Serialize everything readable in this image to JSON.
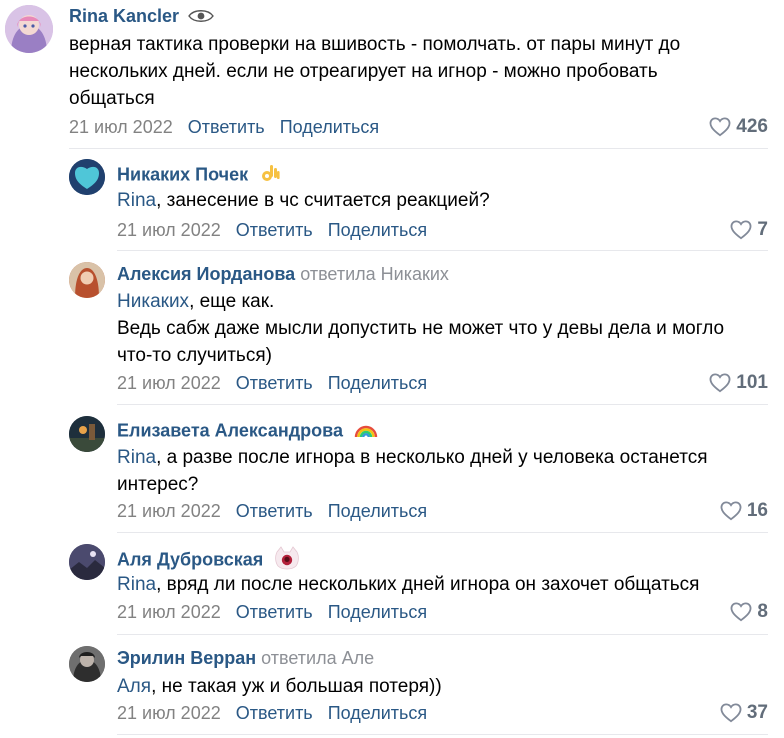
{
  "comments": [
    {
      "author": "Rina Kancler",
      "replied_to": "",
      "mention": "",
      "text": "верная тактика проверки на вшивость - помолчать. от пары минут до нескольких дней. если не отреагирует на игнор - можно пробовать общаться",
      "date": "21 июл 2022",
      "reply": "Ответить",
      "share": "Поделиться",
      "likes": "426"
    },
    {
      "author": "Никаких Почек",
      "replied_to": "",
      "mention": "Rina",
      "text": ", занесение в чс считается реакцией?",
      "date": "21 июл 2022",
      "reply": "Ответить",
      "share": "Поделиться",
      "likes": "7"
    },
    {
      "author": "Алексия Иорданова",
      "replied_to": "ответила Никаких",
      "mention": "Никаких",
      "text": ", еще как.",
      "text2": "Ведь сабж даже мысли допустить не может что у девы дела и могло что-то случиться)",
      "date": "21 июл 2022",
      "reply": "Ответить",
      "share": "Поделиться",
      "likes": "101"
    },
    {
      "author": "Елизавета Александрова",
      "replied_to": "",
      "mention": "Rina",
      "text": ", а разве после игнора в несколько дней у человека останется интерес?",
      "date": "21 июл 2022",
      "reply": "Ответить",
      "share": "Поделиться",
      "likes": "16"
    },
    {
      "author": "Аля Дубровская",
      "replied_to": "",
      "mention": "Rina",
      "text": ", вряд ли после нескольких дней игнора он захочет общаться",
      "date": "21 июл 2022",
      "reply": "Ответить",
      "share": "Поделиться",
      "likes": "8"
    },
    {
      "author": "Эрилин Верран",
      "replied_to": "ответила Але",
      "mention": "Аля",
      "text": ", не такая уж и большая потеря))",
      "date": "21 июл 2022",
      "reply": "Ответить",
      "share": "Поделиться",
      "likes": "37"
    }
  ],
  "icons": {
    "eye": "eye-icon",
    "heart": "heart-icon",
    "ok_hand": "ok-hand-emoji",
    "rainbow": "rainbow-emoji",
    "cat": "cat-emoji"
  },
  "colors": {
    "link": "#2a5885",
    "secondary": "#828282",
    "likes": "#626d7a"
  }
}
